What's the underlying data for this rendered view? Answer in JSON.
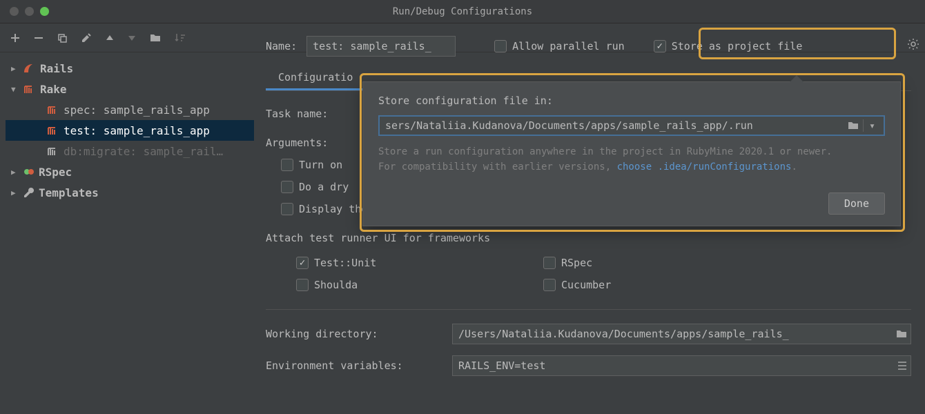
{
  "window": {
    "title": "Run/Debug Configurations"
  },
  "header": {
    "name_label": "Name:",
    "name_value": "test: sample_rails_",
    "allow_parallel": "Allow parallel run",
    "store_file": "Store as project file"
  },
  "sidebar": {
    "items": [
      {
        "label": "Rails"
      },
      {
        "label": "Rake"
      },
      {
        "label": "spec: sample_rails_app"
      },
      {
        "label": "test: sample_rails_app"
      },
      {
        "label": "db:migrate: sample_rail…"
      },
      {
        "label": "RSpec"
      },
      {
        "label": "Templates"
      }
    ]
  },
  "tabs": {
    "config": "Configuratio"
  },
  "form": {
    "task_name": "Task name:",
    "arguments": "Arguments:",
    "turn_on": "Turn on",
    "dry_run": "Do a dry",
    "prereqs": "Display the tasks and dependencies, then exit (--prereqs)",
    "attach_label": "Attach test runner UI for frameworks",
    "fw": {
      "testunit": "Test::Unit",
      "rspec": "RSpec",
      "shoulda": "Shoulda",
      "cucumber": "Cucumber"
    },
    "wd_label": "Working directory:",
    "wd_value": "/Users/Nataliia.Kudanova/Documents/apps/sample_rails_",
    "env_label": "Environment variables:",
    "env_value": "RAILS_ENV=test"
  },
  "popup": {
    "title": "Store configuration file in:",
    "path": "sers/Nataliia.Kudanova/Documents/apps/sample_rails_app/.run",
    "hint1": "Store a run configuration anywhere in the project in RubyMine 2020.1 or newer.",
    "hint2a": "For compatibility with earlier versions, ",
    "hint_link": "choose .idea/runConfigurations",
    "hint2b": ".",
    "done": "Done"
  }
}
